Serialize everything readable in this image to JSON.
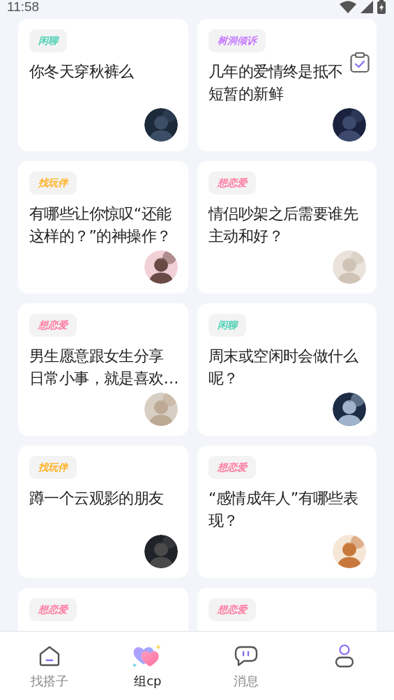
{
  "status_bar": {
    "time": "11:58"
  },
  "cards": [
    {
      "tag": {
        "label": "闲聊",
        "color": "#4fd1b5"
      },
      "text": "你冬天穿秋裤么"
    },
    {
      "tag": {
        "label": "树洞倾诉",
        "color": "#c77dff"
      },
      "lines": [
        "几年的爱情终是抵不",
        "短暂的新鲜"
      ]
    },
    {
      "tag": {
        "label": "找玩伴",
        "color": "#ffb020"
      },
      "text": "有哪些让你惊叹“还能这样的？”的神操作？"
    },
    {
      "tag": {
        "label": "想恋爱",
        "color": "#ff7aa2"
      },
      "text": "情侣吵架之后需要谁先主动和好？"
    },
    {
      "tag": {
        "label": "想恋爱",
        "color": "#ff7aa2"
      },
      "lines": [
        "男生愿意跟女生分享",
        "日常小事，就是喜欢…"
      ]
    },
    {
      "tag": {
        "label": "闲聊",
        "color": "#4fd1b5"
      },
      "text": "周末或空闲时会做什么呢？"
    },
    {
      "tag": {
        "label": "找玩伴",
        "color": "#ffb020"
      },
      "text": "蹲一个云观影的朋友"
    },
    {
      "tag": {
        "label": "想恋爱",
        "color": "#ff7aa2"
      },
      "text": "“感情成年人”有哪些表现？"
    },
    {
      "tag": {
        "label": "想恋爱",
        "color": "#ff7aa2"
      }
    },
    {
      "tag": {
        "label": "想恋爱",
        "color": "#ff7aa2"
      }
    }
  ],
  "tabs": [
    {
      "kind": "home",
      "label": "找搭子",
      "selected": false
    },
    {
      "kind": "hearts",
      "label": "组cp",
      "selected": true
    },
    {
      "kind": "chat",
      "label": "消息",
      "selected": false
    },
    {
      "kind": "person",
      "selected": false
    }
  ]
}
